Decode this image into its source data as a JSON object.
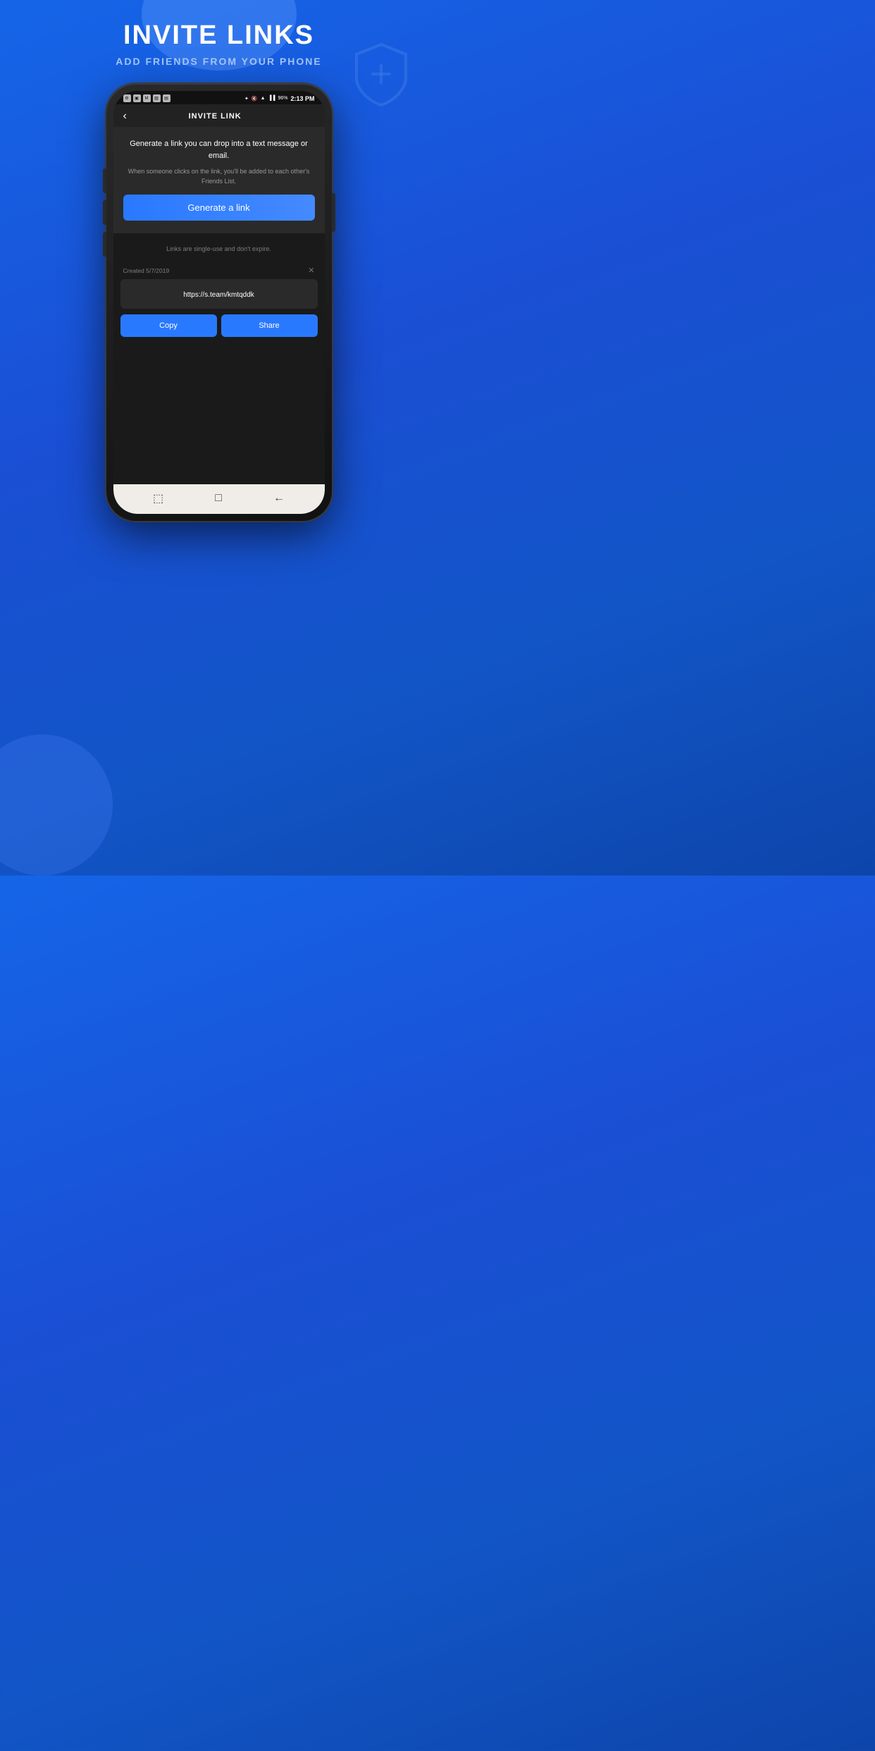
{
  "background": {
    "color_start": "#1565e8",
    "color_end": "#0d45aa"
  },
  "header": {
    "main_title": "INVITE LINKS",
    "sub_title": "ADD FRIENDS FROM YOUR PHONE"
  },
  "phone": {
    "status_bar": {
      "time": "2:13 PM",
      "battery": "96%"
    },
    "nav": {
      "title": "INVITE LINK",
      "back_label": "‹"
    },
    "info_card": {
      "main_text": "Generate a link you can drop into a text message or email.",
      "sub_text": "When someone clicks on the link, you'll be added to each other's Friends List.",
      "generate_button_label": "Generate a link"
    },
    "single_use_note": "Links are single-use and don't expire.",
    "link_card": {
      "created_label": "Created 5/7/2019",
      "url": "https://s.team/kmtqddk",
      "copy_label": "Copy",
      "share_label": "Share"
    },
    "android_nav": {
      "back": "←",
      "home": "□",
      "recent": "⬚"
    }
  }
}
